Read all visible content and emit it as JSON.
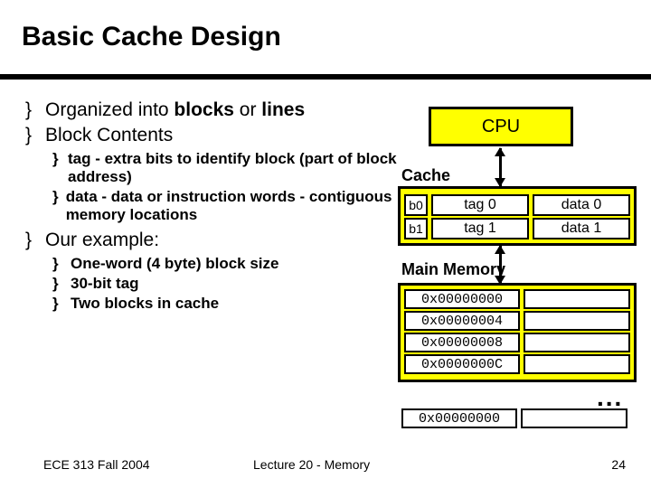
{
  "title": "Basic Cache Design",
  "bullets": {
    "b1": "Organized into ",
    "b1b1": "blocks",
    "b1m": " or ",
    "b1b2": "lines",
    "b2": "Block Contents",
    "b2s1p1": "tag",
    "b2s1p2": " - extra bits to identify block (part of block address)",
    "b2s2p1": "data",
    "b2s2p2": " - data or instruction words - contiguous memory locations",
    "b3": "Our example:",
    "b3s1": "One-word (4 byte) block size",
    "b3s2": "30-bit tag",
    "b3s3": "Two blocks in cache"
  },
  "cpu": "CPU",
  "cache_label": "Cache",
  "cache_rows": {
    "r0c0": "b0",
    "r0c1": "tag 0",
    "r0c2": "data 0",
    "r1c0": "b1",
    "r1c1": "tag 1",
    "r1c2": "data 1"
  },
  "mm_label": "Main Memory",
  "mm": {
    "a0": "0x00000000",
    "a1": "0x00000004",
    "a2": "0x00000008",
    "a3": "0x0000000C",
    "extra": "0x00000000"
  },
  "dots": "...",
  "footer": {
    "left": "ECE 313 Fall 2004",
    "center": "Lecture 20 - Memory",
    "right": "24"
  },
  "marker": "}"
}
